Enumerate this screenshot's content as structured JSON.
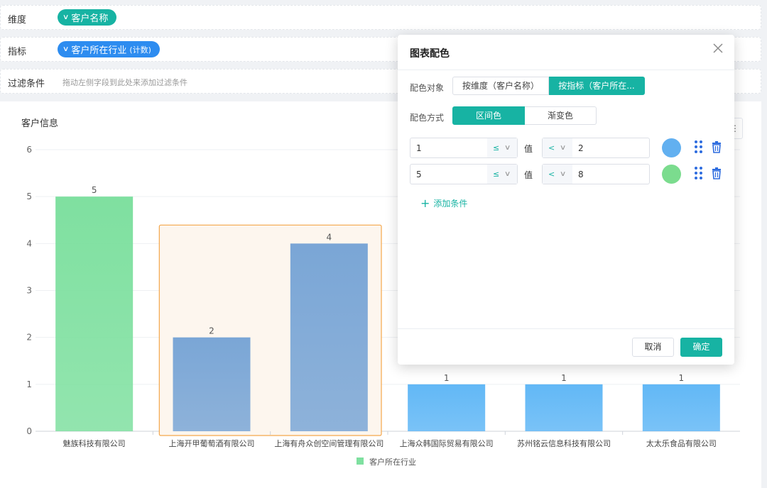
{
  "rows": {
    "dimension": {
      "label": "维度",
      "pill": "客户名称"
    },
    "indicator": {
      "label": "指标",
      "pill": "客户所在行业",
      "pill_sub": "(计数)"
    },
    "filter": {
      "label": "过滤条件",
      "hint": "拖动左侧字段到此处来添加过滤条件"
    }
  },
  "chart": {
    "title": "客户信息",
    "menu_icon": "more-vertical-icon"
  },
  "chart_data": {
    "type": "bar",
    "categories": [
      "魅族科技有限公司",
      "上海开甲葡萄酒有限公司",
      "上海有舟众创空间管理有限公司",
      "上海众韩国际贸易有限公司",
      "苏州铭云信息科技有限公司",
      "太太乐食品有限公司"
    ],
    "values": [
      5,
      2,
      4,
      1,
      1,
      1
    ],
    "bar_colors": [
      "#7fe0a0",
      "#7aa6d6",
      "#7aa6d6",
      "#62b8f6",
      "#62b8f6",
      "#62b8f6"
    ],
    "ylim": [
      0,
      6
    ],
    "yticks": [
      "0",
      "1",
      "2",
      "3",
      "4",
      "5",
      "6"
    ],
    "legend": "客户所在行业",
    "legend_color": "#7fe0a0",
    "legend_position": "bottom-center",
    "grid": true,
    "highlight_categories": [
      "上海开甲葡萄酒有限公司",
      "上海有舟众创空间管理有限公司"
    ],
    "highlight_color": "#f4a64a"
  },
  "dialog": {
    "title": "图表配色",
    "close_icon": "close-icon",
    "color_target_label": "配色对象",
    "color_target_options": [
      "按维度（客户名称）",
      "按指标（客户所在..."
    ],
    "color_target_active": 1,
    "color_mode_label": "配色方式",
    "color_mode_options": [
      "区间色",
      "渐变色"
    ],
    "color_mode_active": 0,
    "value_label": "值",
    "conditions": [
      {
        "from": "1",
        "op_left": "≤",
        "op_right": "<",
        "to": "2",
        "color": "#62b0f0"
      },
      {
        "from": "5",
        "op_left": "≤",
        "op_right": "<",
        "to": "8",
        "color": "#7bdc8e"
      }
    ],
    "add_condition": "添加条件",
    "cancel": "取消",
    "ok": "确定"
  },
  "colors": {
    "accent": "#17b3a3",
    "blue": "#2d8cf0"
  }
}
